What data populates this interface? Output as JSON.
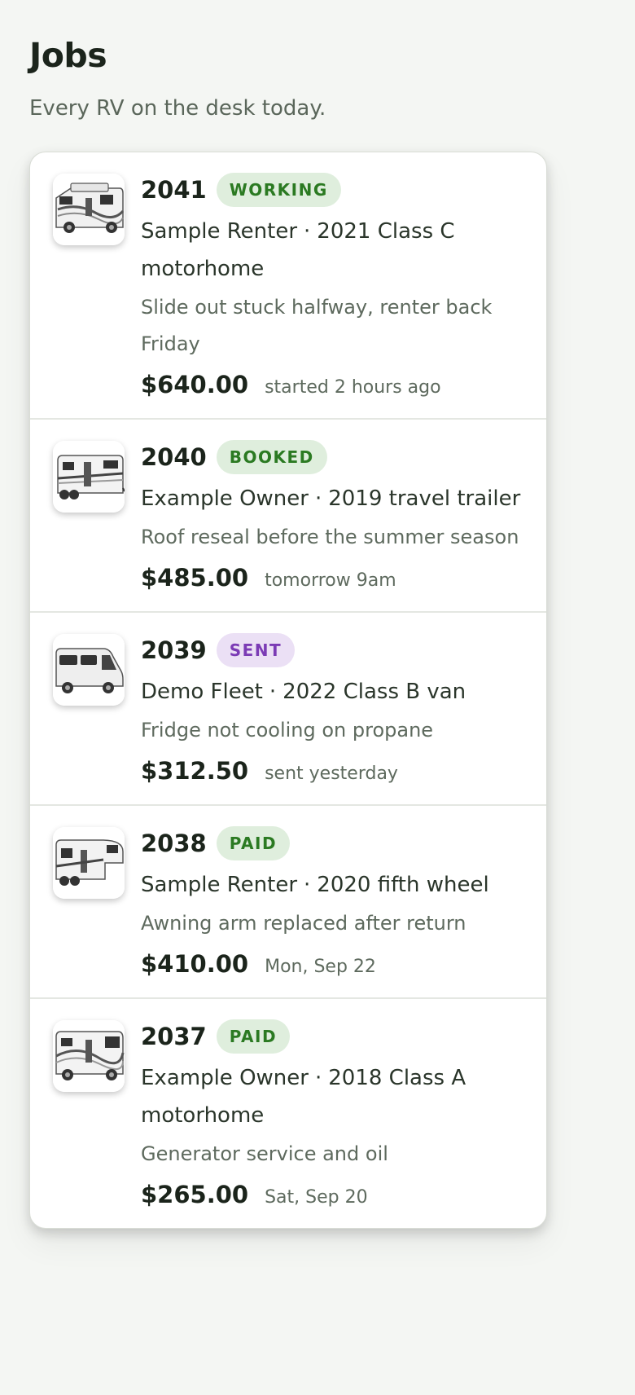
{
  "header": {
    "title": "Jobs",
    "subtitle": "Every RV on the desk today."
  },
  "jobs": [
    {
      "number": "2041",
      "status": "WORKING",
      "status_color": "green",
      "customer": "Sample Renter",
      "separator": "·",
      "vehicle": "2021 Class C motorhome",
      "description": "Slide out stuck halfway, renter back Friday",
      "amount": "$640.00",
      "when": "started 2 hours ago",
      "thumb_icon": "class-c-motorhome-photo"
    },
    {
      "number": "2040",
      "status": "BOOKED",
      "status_color": "green",
      "customer": "Example Owner",
      "separator": "·",
      "vehicle": "2019 travel trailer",
      "description": "Roof reseal before the summer season",
      "amount": "$485.00",
      "when": "tomorrow 9am",
      "thumb_icon": "travel-trailer-photo"
    },
    {
      "number": "2039",
      "status": "SENT",
      "status_color": "purple",
      "customer": "Demo Fleet",
      "separator": "·",
      "vehicle": "2022 Class B van",
      "description": "Fridge not cooling on propane",
      "amount": "$312.50",
      "when": "sent yesterday",
      "thumb_icon": "class-b-van-photo"
    },
    {
      "number": "2038",
      "status": "PAID",
      "status_color": "green",
      "customer": "Sample Renter",
      "separator": "·",
      "vehicle": "2020 fifth wheel",
      "description": "Awning arm replaced after return",
      "amount": "$410.00",
      "when": "Mon, Sep 22",
      "thumb_icon": "fifth-wheel-photo"
    },
    {
      "number": "2037",
      "status": "PAID",
      "status_color": "green",
      "customer": "Example Owner",
      "separator": "·",
      "vehicle": "2018 Class A motorhome",
      "description": "Generator service and oil",
      "amount": "$265.00",
      "when": "Sat, Sep 20",
      "thumb_icon": "class-a-motorhome-photo"
    }
  ],
  "colors": {
    "page_background": "#f4f6f3",
    "badge_green_bg": "#dfeedd",
    "badge_green_text": "#2b7a22",
    "badge_purple_bg": "#ebe0f5",
    "badge_purple_text": "#7b3bb5"
  }
}
